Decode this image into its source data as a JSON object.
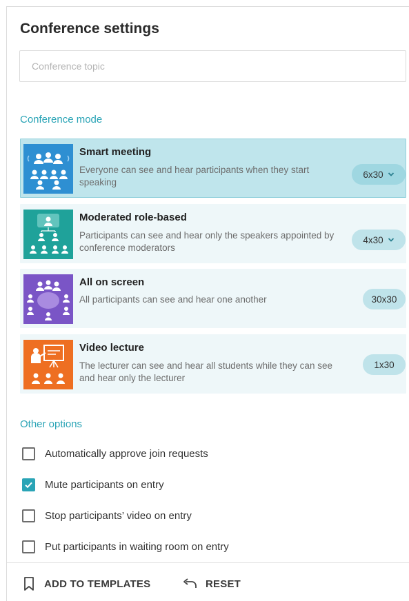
{
  "title": "Conference settings",
  "topic": {
    "placeholder": "Conference topic",
    "value": ""
  },
  "modes_label": "Conference mode",
  "modes": [
    {
      "title": "Smart meeting",
      "description": "Everyone can see and hear participants when they start speaking",
      "layout": "6x30",
      "has_dropdown": true,
      "selected": true,
      "icon": "smart-meeting-icon",
      "color": "#2e8fd2"
    },
    {
      "title": "Moderated role-based",
      "description": "Participants can see and hear only the speakers appointed by conference moderators",
      "layout": "4x30",
      "has_dropdown": true,
      "selected": false,
      "icon": "moderated-role-icon",
      "color": "#1fa29a"
    },
    {
      "title": "All on screen",
      "description": "All participants can see and hear one another",
      "layout": "30x30",
      "has_dropdown": false,
      "selected": false,
      "icon": "all-on-screen-icon",
      "color": "#7a55c6"
    },
    {
      "title": "Video lecture",
      "description": "The lecturer can see and hear all students while they can see and hear only the lecturer",
      "layout": "1x30",
      "has_dropdown": false,
      "selected": false,
      "icon": "video-lecture-icon",
      "color": "#ee6f22"
    }
  ],
  "options_label": "Other options",
  "options": [
    {
      "label": "Automatically approve join requests",
      "checked": false
    },
    {
      "label": "Mute participants on entry",
      "checked": true
    },
    {
      "label": "Stop participants’ video on entry",
      "checked": false
    },
    {
      "label": "Put participants in waiting room on entry",
      "checked": false
    }
  ],
  "footer": {
    "add_to_templates": "ADD TO TEMPLATES",
    "add_icon": "bookmark-icon",
    "reset": "RESET",
    "reset_icon": "undo-icon"
  },
  "colors": {
    "accent": "#2aa4b6",
    "selected_bg": "#bfe5ec",
    "card_bg": "#eef7f9"
  }
}
